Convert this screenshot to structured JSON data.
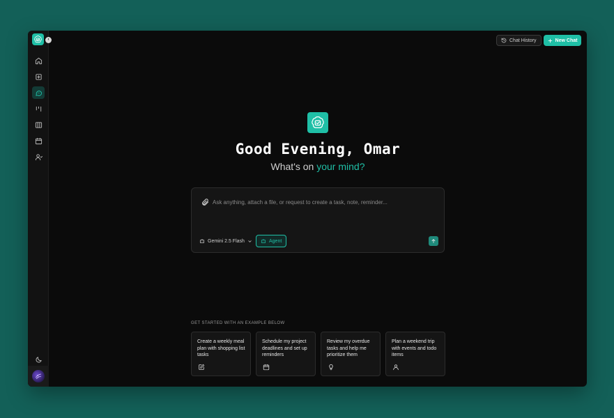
{
  "header": {
    "history_label": "Chat History",
    "new_chat_label": "New Chat"
  },
  "sidebar": {
    "items": [
      {
        "icon": "home-icon",
        "active": false
      },
      {
        "icon": "add-note-icon",
        "active": false
      },
      {
        "icon": "chat-icon",
        "active": true
      },
      {
        "icon": "kanban-icon",
        "active": false
      },
      {
        "icon": "columns-icon",
        "active": false
      },
      {
        "icon": "calendar-icon",
        "active": false
      },
      {
        "icon": "user-icon",
        "active": false
      }
    ],
    "theme_icon": "moon-icon",
    "avatar_icon": "avatar"
  },
  "hero": {
    "greeting": "Good Evening, Omar",
    "sub_prefix": "What's on ",
    "sub_accent": "your mind?"
  },
  "composer": {
    "placeholder": "Ask anything, attach a file, or request to create a task, note, reminder...",
    "model": "Gemini 2.5 Flash",
    "agent_label": "Agent"
  },
  "examples": {
    "heading": "GET STARTED WITH AN EXAMPLE BELOW",
    "cards": [
      {
        "text": "Create a weekly meal plan with shopping list tasks",
        "icon": "edit-icon"
      },
      {
        "text": "Schedule my project deadlines and set up reminders",
        "icon": "calendar-icon"
      },
      {
        "text": "Review my overdue tasks and help me prioritize them",
        "icon": "lightbulb-icon"
      },
      {
        "text": "Plan a weekend trip with events and todo items",
        "icon": "user-icon"
      }
    ]
  },
  "colors": {
    "accent": "#1fbfa6",
    "background": "#136058",
    "panel": "#0b0b0b"
  }
}
